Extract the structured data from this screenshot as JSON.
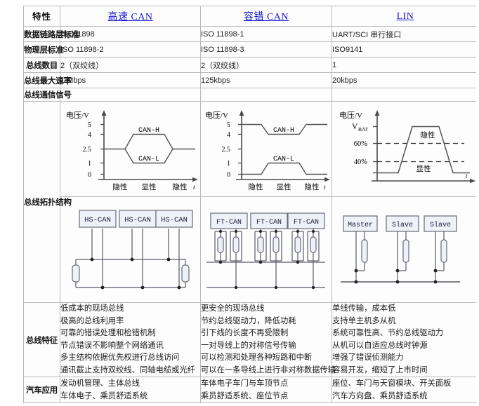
{
  "table": {
    "header": {
      "feature_label": "特性",
      "columns": [
        "高速 CAN",
        "容错 CAN",
        "LIN"
      ]
    },
    "rows": [
      {
        "label": "数据链路层标准",
        "values": [
          "ISO11898",
          "ISO 11898-1",
          "UART/SCI 串行接口"
        ]
      },
      {
        "label": "物理层标准",
        "values": [
          "ISO 11898-2",
          "ISO 11898-3",
          "ISO9141"
        ]
      },
      {
        "label": "总线数目",
        "values": [
          "2（双绞线）",
          "2（双绞线）",
          "1"
        ]
      },
      {
        "label": "总线最大速率",
        "values": [
          "1 Mbps",
          "125kbps",
          "20kbps"
        ]
      },
      {
        "label": "总线通信信号",
        "values": [
          "",
          "",
          ""
        ]
      }
    ],
    "topology_label": "总线拓扑结构",
    "features_label": "总线特征",
    "application_label": "汽车应用",
    "features": {
      "hs_can": [
        "低成本的现场总线",
        "极高的总线利用率",
        "可靠的错误处理和检错机制",
        "节点错误不影响整个网络通讯",
        "多主结构依据优先权进行总线访问",
        "通讯截止支持双绞线、同轴电缆或光纤"
      ],
      "ft_can": [
        "更安全的现场总线",
        "节约总线驱动力，降低功耗",
        "引下线的长度不再受限制",
        "一对导线上的对称信号传输",
        "可以检测和处理各种短路和中断",
        "可以在一条导线上进行非对称数据传输"
      ],
      "lin": [
        "单线传输，成本低",
        "支持单主机多从机",
        "系统可靠性高、节约总线驱动力",
        "从机可以自适应总线时钟源",
        "增强了错误侦测能力",
        "容易开发，缩短了上市时间"
      ]
    },
    "applications": {
      "hs_can": [
        "发动机管理、主体总线",
        "车体电子、乘员舒适系统"
      ],
      "ft_can": [
        "车体电子车门与车顶节点",
        "乘员舒适系统、座位节点"
      ],
      "lin": [
        "座位、车门与天窗模块、开关面板",
        "汽车方向盘、乘员舒适系统"
      ]
    }
  },
  "signal_diagrams": {
    "hs_can": {
      "y_axis_label": "电压/V",
      "x_axis_label": "t",
      "y_ticks": [
        "5",
        "4",
        "2.5",
        "1",
        "0"
      ],
      "trace_labels": [
        "CAN-H",
        "CAN-L"
      ],
      "state_labels": [
        "隐性",
        "显性",
        "隐性"
      ]
    },
    "ft_can": {
      "y_axis_label": "电压/V",
      "x_axis_label": "t",
      "y_ticks": [
        "5",
        "4",
        "2.5",
        "1",
        "0"
      ],
      "trace_labels": [
        "CAN-H",
        "CAN-L"
      ],
      "state_labels": [
        "隐性",
        "显性",
        "隐性"
      ]
    },
    "lin": {
      "y_axis_label": "电压/V",
      "x_axis_label": "t",
      "y_ticks": [
        "V",
        "BAT",
        "60%",
        "40%"
      ],
      "state_labels": [
        "隐性",
        "显性"
      ]
    }
  },
  "topology_diagrams": {
    "hs_can": {
      "nodes": [
        "HS-CAN",
        "HS-CAN",
        "HS-CAN"
      ],
      "wires": 2,
      "terminators": 2
    },
    "ft_can": {
      "nodes": [
        "FT-CAN",
        "FT-CAN",
        "FT-CAN"
      ],
      "wires": 2,
      "terminators": 6
    },
    "lin": {
      "nodes": [
        "Master",
        "Slave",
        "Slave"
      ],
      "wires": 1,
      "terminators": 3
    }
  },
  "colors": {
    "header_bg": "#e2e2f0",
    "link_text": "#1414cf",
    "border": "#b9b9b9",
    "node_fill": "#eef1f8",
    "line": "#555555"
  }
}
